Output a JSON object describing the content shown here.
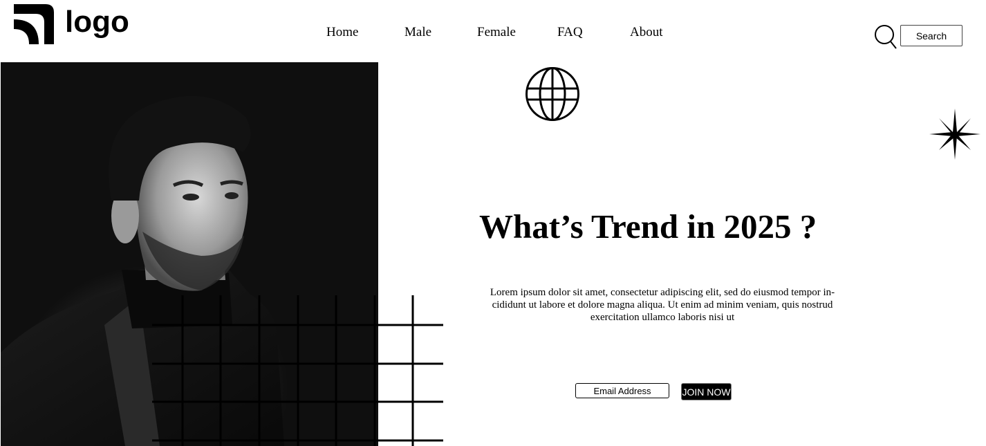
{
  "brand": {
    "logo_text": "logo"
  },
  "nav": {
    "items": [
      {
        "label": "Home"
      },
      {
        "label": "Male"
      },
      {
        "label": "Female"
      },
      {
        "label": "FAQ"
      },
      {
        "label": "About"
      }
    ]
  },
  "search": {
    "button_label": "Search",
    "icon": "search-icon"
  },
  "hero": {
    "headline": "What’s Trend in 2025 ?",
    "body": "Lorem ipsum dolor sit amet, consectetur adipiscing elit, sed do eiusmod tempor in-cididunt ut labore et dolore magna aliqua. Ut enim ad minim veniam, quis nostrud exercitation ullamco laboris nisi ut",
    "email_placeholder": "Email Address",
    "join_label": "JOIN NOW",
    "icons": [
      "globe-icon",
      "sparkle-star-icon"
    ]
  },
  "colors": {
    "background": "#ffffff",
    "ink": "#000000",
    "button_bg": "#000000",
    "button_text": "#ffffff"
  }
}
